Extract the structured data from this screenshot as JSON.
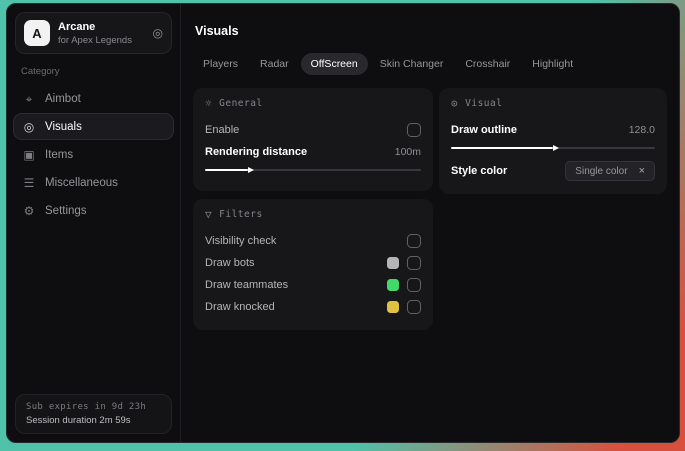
{
  "app": {
    "logo_letter": "A",
    "title": "Arcane",
    "subtitle": "for Apex Legends"
  },
  "icons": {
    "sidebar_gear": "◎",
    "aimbot": "⌖",
    "visuals": "◎",
    "items": "▣",
    "miscellaneous": "☰",
    "settings": "⚙",
    "general": "☼",
    "visual": "⊙",
    "filters": "▽",
    "tag_close": "×"
  },
  "sidebar": {
    "category_label": "Category",
    "items": [
      {
        "label": "Aimbot",
        "selected": false
      },
      {
        "label": "Visuals",
        "selected": true
      },
      {
        "label": "Items",
        "selected": false
      },
      {
        "label": "Miscellaneous",
        "selected": false
      },
      {
        "label": "Settings",
        "selected": false
      }
    ],
    "footer": {
      "line1": "Sub expires in 9d 23h",
      "line2": "Session duration 2m 59s"
    }
  },
  "main": {
    "title": "Visuals",
    "tabs": [
      {
        "label": "Players",
        "active": false
      },
      {
        "label": "Radar",
        "active": false
      },
      {
        "label": "OffScreen",
        "active": true
      },
      {
        "label": "Skin Changer",
        "active": false
      },
      {
        "label": "Crosshair",
        "active": false
      },
      {
        "label": "Highlight",
        "active": false
      }
    ],
    "general": {
      "header": "General",
      "enable_label": "Enable",
      "enable_checked": false,
      "rendering_label": "Rendering distance",
      "rendering_value": "100m",
      "rendering_percent": 20
    },
    "visual": {
      "header": "Visual",
      "outline_label": "Draw outline",
      "outline_value": "128.0",
      "outline_percent": 50,
      "style_label": "Style color",
      "style_value": "Single color"
    },
    "filters": {
      "header": "Filters",
      "rows": [
        {
          "label": "Visibility check",
          "swatch": "",
          "checked": false
        },
        {
          "label": "Draw bots",
          "swatch": "#b5b5b5",
          "checked": false
        },
        {
          "label": "Draw teammates",
          "swatch": "#44d868",
          "checked": false
        },
        {
          "label": "Draw knocked",
          "swatch": "#e0c243",
          "checked": false
        }
      ]
    }
  },
  "colors": {
    "background_teal": "#4fc2a9",
    "background_red": "#d8503d",
    "window_bg": "#0e0e10",
    "card_bg": "#17171a",
    "accent_text": "#ffffff"
  }
}
